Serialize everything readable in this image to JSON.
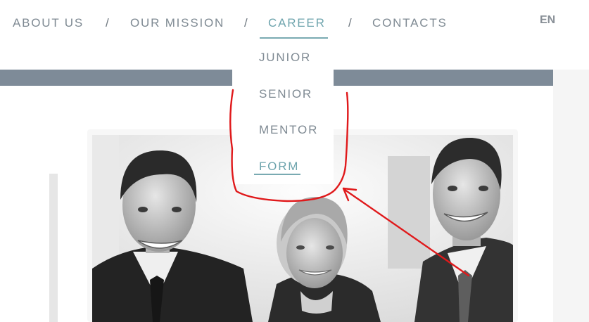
{
  "nav": {
    "items": [
      {
        "label": "ABOUT US"
      },
      {
        "label": "OUR MISSION"
      },
      {
        "label": "CAREER"
      },
      {
        "label": "CONTACTS"
      }
    ],
    "separator": "/",
    "active": "CAREER",
    "language": "EN"
  },
  "dropdown": {
    "items": [
      {
        "label": "JUNIOR"
      },
      {
        "label": "SENIOR"
      },
      {
        "label": "MENTOR"
      },
      {
        "label": "FORM"
      }
    ],
    "active": "FORM"
  },
  "colors": {
    "nav_text": "#7f8a93",
    "accent": "#6ea4ad",
    "header_band": "#7e8b98",
    "annotation": "#e0191b"
  },
  "content": {
    "photo": "team-photo"
  }
}
